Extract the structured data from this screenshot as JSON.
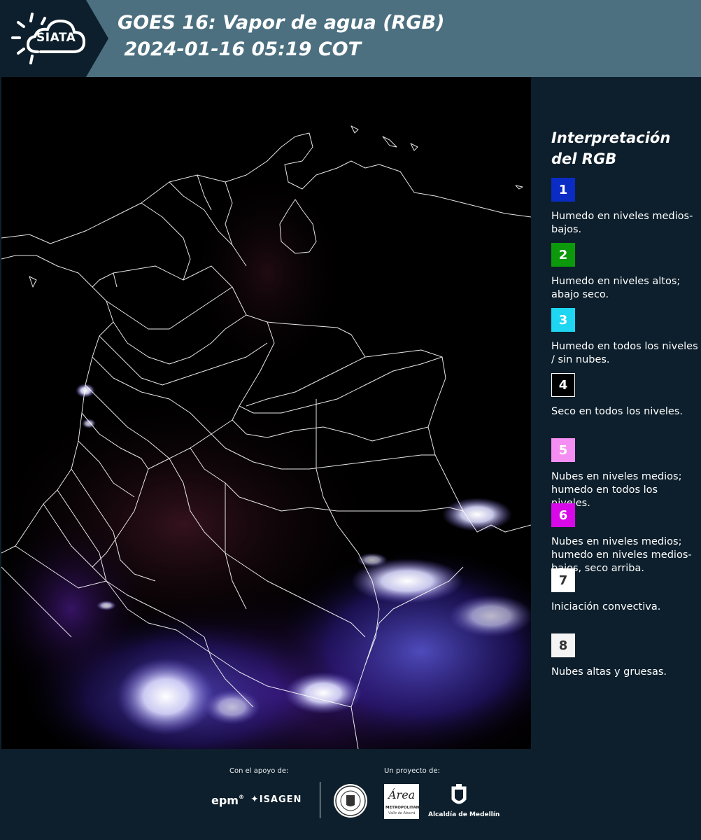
{
  "header": {
    "logo_text": "SIATA",
    "title_line1": "GOES 16: Vapor de agua (RGB)",
    "title_line2": " 2024-01-16 05:19 COT"
  },
  "map": {
    "icon": "satellite-image"
  },
  "legend": {
    "title_line1": "Interpretación",
    "title_line2": "del RGB",
    "items": [
      {
        "num": "1",
        "color": "#0a2cc4",
        "text_color": "#ffffff",
        "desc": "Humedo en niveles medios-bajos."
      },
      {
        "num": "2",
        "color": "#0c9a0c",
        "text_color": "#ffffff",
        "desc": "Humedo en niveles altos; abajo seco."
      },
      {
        "num": "3",
        "color": "#1ed6f2",
        "text_color": "#ffffff",
        "desc": "Humedo en todos los niveles / sin nubes."
      },
      {
        "num": "4",
        "color": "#000000",
        "text_color": "#ffffff",
        "desc": "Seco en todos los niveles."
      },
      {
        "num": "5",
        "color": "#f58ef2",
        "text_color": "#ffffff",
        "desc": "Nubes en niveles medios; humedo en todos los niveles."
      },
      {
        "num": "6",
        "color": "#d808e8",
        "text_color": "#ffffff",
        "desc": "Nubes en niveles medios; humedo en niveles medios-bajos, seco arriba."
      },
      {
        "num": "7",
        "color": "#ffffff",
        "text_color": "#333333",
        "desc": "Iniciación convectiva."
      },
      {
        "num": "8",
        "color": "#f4f4f4",
        "text_color": "#333333",
        "desc": "Nubes altas y gruesas."
      }
    ]
  },
  "footer": {
    "support_label": "Con el apoyo de:",
    "project_label": "Un proyecto de:",
    "brand_epm": "epm",
    "brand_isagen": "ISAGEN",
    "area_text": "Área",
    "area_sub": "METROPOLITANA",
    "area_sub2": "Valle de Aburrá",
    "medellin_text": "Alcaldía de Medellín"
  }
}
